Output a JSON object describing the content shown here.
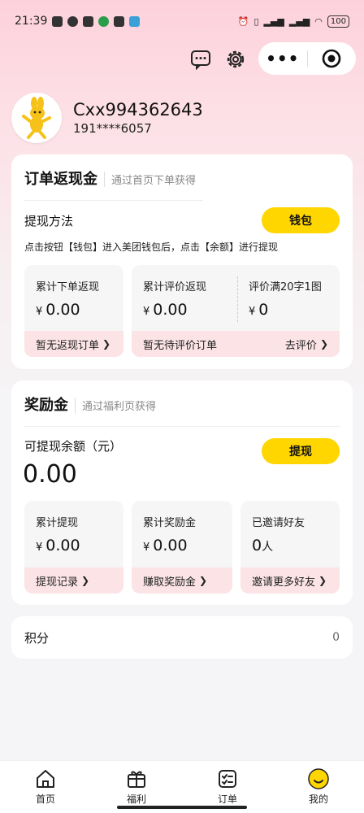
{
  "status_bar": {
    "time": "21:39",
    "battery": "100"
  },
  "user": {
    "name": "Cxx994362643",
    "phone": "191****6057"
  },
  "order_cashback": {
    "title": "订单返现金",
    "subtitle": "通过首页下单获得",
    "withdraw_method_label": "提现方法",
    "wallet_button": "钱包",
    "instruction": "点击按钮【钱包】进入美团钱包后，点击【余额】进行提现",
    "cumulative_order_label": "累计下单返现",
    "cumulative_order_value": "0.00",
    "no_order_link": "暂无返现订单",
    "cumulative_review_label": "累计评价返现",
    "cumulative_review_value": "0.00",
    "review_rule_label": "评价满20字1图",
    "review_rule_value": "0",
    "no_review_text": "暂无待评价订单",
    "go_review_link": "去评价",
    "currency": "¥"
  },
  "bonus": {
    "title": "奖励金",
    "subtitle": "通过福利页获得",
    "withdrawable_label": "可提现余额（元）",
    "withdrawable_value": "0.00",
    "withdraw_button": "提现",
    "cumulative_withdraw_label": "累计提现",
    "cumulative_withdraw_value": "0.00",
    "withdraw_record_link": "提现记录",
    "cumulative_bonus_label": "累计奖励金",
    "cumulative_bonus_value": "0.00",
    "earn_bonus_link": "赚取奖励金",
    "invited_label": "已邀请好友",
    "invited_value": "0",
    "invited_unit": "人",
    "invite_more_link": "邀请更多好友",
    "currency": "¥"
  },
  "points": {
    "label": "积分",
    "value": "0"
  },
  "tabbar": {
    "home": "首页",
    "welfare": "福利",
    "orders": "订单",
    "mine": "我的"
  },
  "colors": {
    "accent": "#ffd600",
    "footer_pink": "#fbe3e6"
  }
}
